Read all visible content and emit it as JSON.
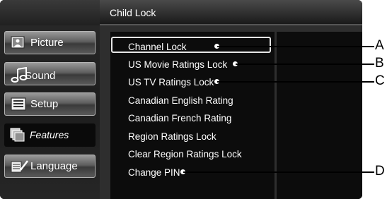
{
  "header": {
    "title": "Child Lock"
  },
  "sidebar": {
    "items": [
      {
        "label": "Picture",
        "icon": "picture-icon"
      },
      {
        "label": "Sound",
        "icon": "sound-icon"
      },
      {
        "label": "Setup",
        "icon": "setup-icon"
      },
      {
        "label": "Features",
        "icon": "features-icon",
        "active": true
      },
      {
        "label": "Language",
        "icon": "language-icon"
      }
    ]
  },
  "menu": {
    "items": [
      "Channel Lock",
      "US Movie Ratings Lock",
      "US TV Ratings Lock",
      "Canadian English Rating",
      "Canadian French Rating",
      "Region Ratings Lock",
      "Clear Region Ratings Lock",
      "Change PIN"
    ],
    "selected": "Channel Lock"
  },
  "callouts": [
    "A",
    "B",
    "C",
    "D"
  ]
}
